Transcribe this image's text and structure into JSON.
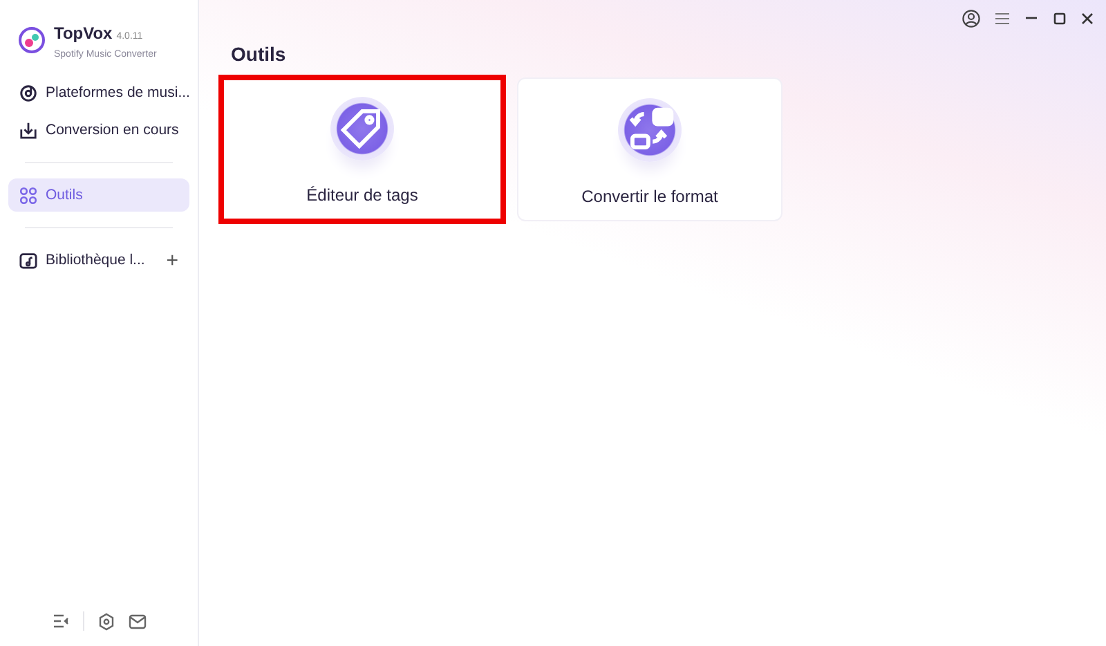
{
  "app": {
    "name": "TopVox",
    "version": "4.0.11",
    "subtitle": "Spotify Music Converter"
  },
  "sidebar": {
    "items": [
      {
        "kind": "music",
        "label": "Plateformes de musi...",
        "selected": false
      },
      {
        "kind": "download",
        "label": "Conversion en cours",
        "selected": false
      },
      {
        "kind": "divider"
      },
      {
        "kind": "tools",
        "label": "Outils",
        "selected": true
      },
      {
        "kind": "divider"
      },
      {
        "kind": "library",
        "label": "Bibliothèque l...",
        "selected": false,
        "add": "+"
      }
    ]
  },
  "page_title": "Outils",
  "tools": [
    {
      "kind": "tag",
      "label": "Éditeur de tags",
      "highlighted": true
    },
    {
      "kind": "convert",
      "label": "Convertir le format",
      "highlighted": false
    }
  ]
}
